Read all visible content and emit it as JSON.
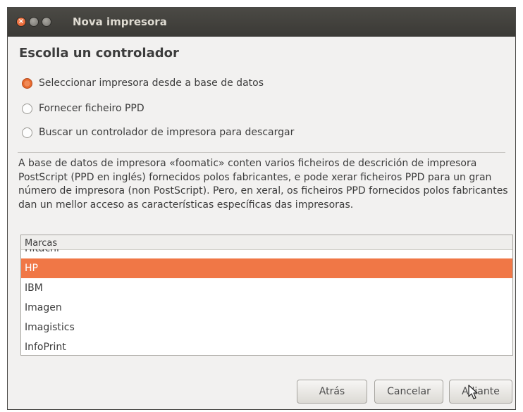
{
  "window": {
    "title": "Nova impresora"
  },
  "heading": "Escolla un controlador",
  "options": [
    {
      "label": "Seleccionar impresora desde a base de datos",
      "checked": true
    },
    {
      "label": "Fornecer ficheiro PPD",
      "checked": false
    },
    {
      "label": "Buscar un controlador de impresora para descargar",
      "checked": false
    }
  ],
  "description": "A base de datos de impresora «foomatic» conten varios ficheiros de descrición de impresora PostScript (PPD en inglés) fornecidos polos fabricantes, e pode xerar ficheiros PPD para un gran número de impresora (non PostScript). Pero, en xeral, os ficheiros PPD fornecidos polos fabricantes dan un mellor acceso as características específicas das impresoras.",
  "list": {
    "header": "Marcas",
    "items": [
      "Hitachi",
      "HP",
      "IBM",
      "Imagen",
      "Imagistics",
      "InfoPrint"
    ],
    "selected": "HP"
  },
  "buttons": {
    "back": "Atrás",
    "cancel": "Cancelar",
    "next": "Adiante"
  },
  "colors": {
    "accent": "#f07746",
    "titlebar": "#3f3e3a"
  }
}
